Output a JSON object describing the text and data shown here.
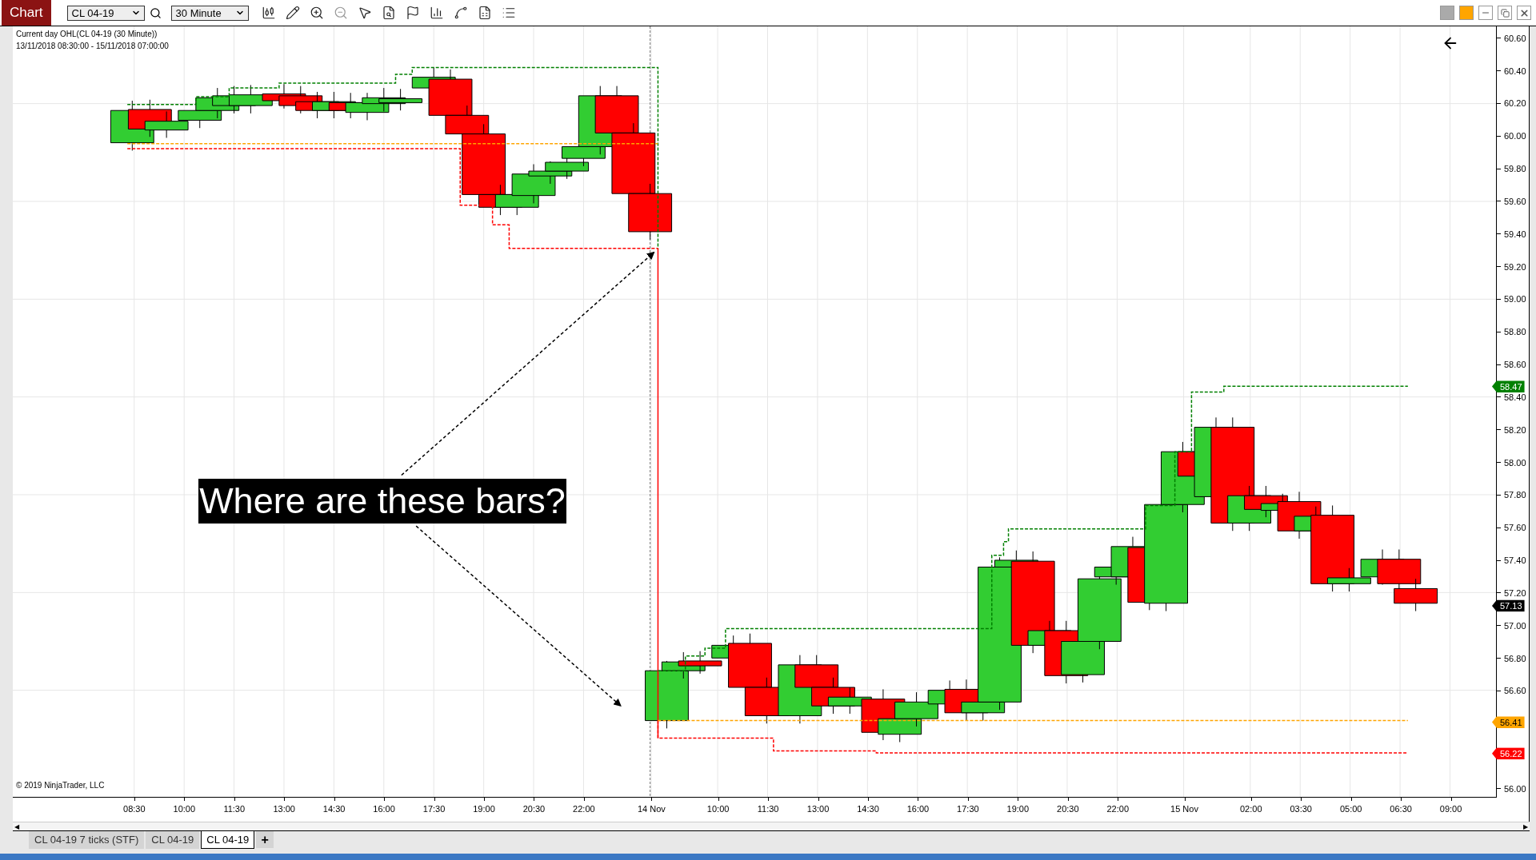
{
  "app_badge": "Chart",
  "toolbar": {
    "instrument": "CL 04-19",
    "interval": "30 Minute"
  },
  "chart": {
    "indicator_title": "Current day OHL(CL 04-19 (30 Minute))",
    "date_range": "13/11/2018 08:30:00 - 15/11/2018 07:00:00",
    "copyright": "© 2019 NinjaTrader, LLC",
    "callout": "Where are these bars?",
    "price_ticks": [
      "60.60",
      "60.40",
      "60.20",
      "60.00",
      "59.80",
      "59.60",
      "59.40",
      "59.20",
      "59.00",
      "58.80",
      "58.60",
      "58.40",
      "58.20",
      "58.00",
      "57.80",
      "57.60",
      "57.40",
      "57.20",
      "57.00",
      "56.80",
      "56.60",
      "56.00"
    ],
    "time_ticks": [
      "08:30",
      "10:00",
      "11:30",
      "13:00",
      "14:30",
      "16:00",
      "17:30",
      "19:00",
      "20:30",
      "22:00",
      "14 Nov",
      "10:00",
      "11:30",
      "13:00",
      "14:30",
      "16:00",
      "17:30",
      "19:00",
      "20:30",
      "22:00",
      "15 Nov",
      "02:00",
      "03:30",
      "05:00",
      "06:30",
      "09:00"
    ],
    "price_markers": [
      {
        "label": "58.47",
        "color": "#008000"
      },
      {
        "label": "57.13",
        "color": "#000000"
      },
      {
        "label": "56.41",
        "color": "#ffa500"
      },
      {
        "label": "56.22",
        "color": "#ff0000"
      }
    ]
  },
  "tabs": [
    {
      "label": "CL 04-19 7 ticks (STF)",
      "selected": false
    },
    {
      "label": "CL 04-19",
      "selected": false
    },
    {
      "label": "CL 04-19",
      "selected": true
    }
  ],
  "new_tab": "+",
  "scrollbar": {
    "left_arrow": "◀",
    "right_arrow": "▶"
  }
}
